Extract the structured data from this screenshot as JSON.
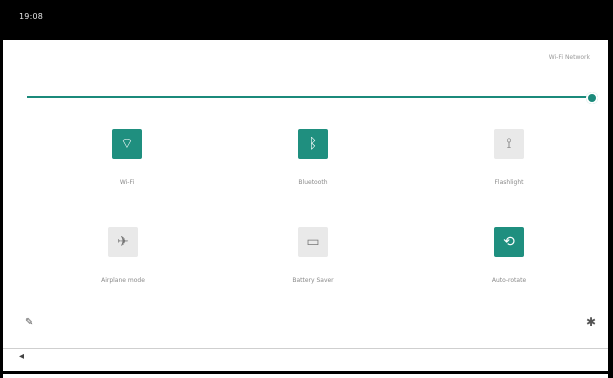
{
  "status_bar": {
    "time": "19:08"
  },
  "quick_settings": {
    "network_label": "Wi-Fi Network",
    "brightness": 1.0,
    "tiles": [
      {
        "label": "Wi-Fi",
        "state": "on",
        "icon": "wifi-icon",
        "glyph": "⌔"
      },
      {
        "label": "Bluetooth",
        "state": "on",
        "icon": "bluetooth-icon",
        "glyph": "ᛒ"
      },
      {
        "label": "Flashlight",
        "state": "off",
        "icon": "flashlight-icon",
        "glyph": "⟟"
      },
      {
        "label": "Airplane mode",
        "state": "off",
        "icon": "airplane-icon",
        "glyph": "✈"
      },
      {
        "label": "Battery Saver",
        "state": "off",
        "icon": "battery-saver-icon",
        "glyph": "▭"
      },
      {
        "label": "Auto-rotate",
        "state": "on",
        "icon": "auto-rotate-icon",
        "glyph": "⟲"
      }
    ]
  },
  "colors": {
    "accent": "#1f8f7f",
    "status_bar": "#000000",
    "tile_off": "#e9e9e9"
  },
  "bottom_bar": {
    "icon": "nav-icon",
    "glyph": "◂"
  }
}
